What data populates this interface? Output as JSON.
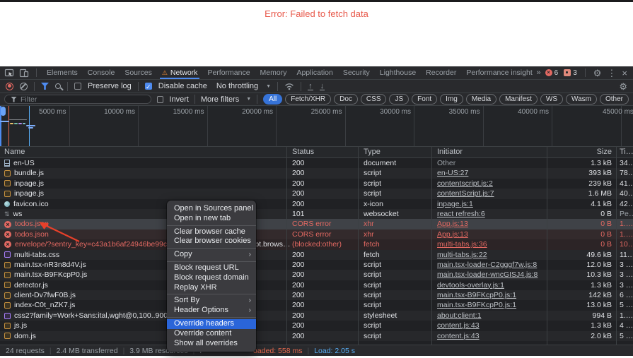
{
  "banner": {
    "text": "Error: Failed to fetch data"
  },
  "tabs": {
    "items": [
      {
        "label": "Elements"
      },
      {
        "label": "Console"
      },
      {
        "label": "Sources"
      },
      {
        "label": "Network",
        "selected": true,
        "warning": true
      },
      {
        "label": "Performance"
      },
      {
        "label": "Memory"
      },
      {
        "label": "Application"
      },
      {
        "label": "Security"
      },
      {
        "label": "Lighthouse"
      },
      {
        "label": "Recorder"
      },
      {
        "label": "Performance insights",
        "flask": true
      }
    ],
    "overflow_chevron": "»",
    "error_count": "6",
    "issue_count": "3"
  },
  "toolbar": {
    "preserve_log_label": "Preserve log",
    "disable_cache_label": "Disable cache",
    "throttling_value": "No throttling",
    "check_glyph": "✓"
  },
  "filterbar": {
    "placeholder": "Filter",
    "invert_label": "Invert",
    "more_filters_label": "More filters",
    "chips": [
      "All",
      "Fetch/XHR",
      "Doc",
      "CSS",
      "JS",
      "Font",
      "Img",
      "Media",
      "Manifest",
      "WS",
      "Wasm",
      "Other"
    ],
    "active_chip": "All"
  },
  "timeline": {
    "ticks": [
      "5000 ms",
      "10000 ms",
      "15000 ms",
      "20000 ms",
      "25000 ms",
      "30000 ms",
      "35000 ms",
      "40000 ms",
      "45000 ms"
    ],
    "tick_spacing_px": 97.5
  },
  "table": {
    "columns": {
      "name": "Name",
      "status": "Status",
      "type": "Type",
      "initiator": "Initiator",
      "size": "Size",
      "time": "Ti…"
    },
    "rows": [
      {
        "name": "en-US",
        "icon": "document-icon",
        "status": "200",
        "type": "document",
        "initiator": "Other",
        "initiator_style": "muted",
        "size": "1.3 kB",
        "time": "34…"
      },
      {
        "name": "bundle.js",
        "icon": "script-icon",
        "status": "200",
        "type": "script",
        "initiator": "en-US:27",
        "initiator_style": "link",
        "size": "393 kB",
        "time": "78…"
      },
      {
        "name": "inpage.js",
        "icon": "script-icon",
        "status": "200",
        "type": "script",
        "initiator": "contentscript.js:2",
        "initiator_style": "link",
        "size": "239 kB",
        "time": "41…"
      },
      {
        "name": "inpage.js",
        "icon": "script-icon",
        "status": "200",
        "type": "script",
        "initiator": "contentScript.js:7",
        "initiator_style": "link",
        "size": "1.6 MB",
        "time": "40…"
      },
      {
        "name": "favicon.ico",
        "icon": "image-icon",
        "status": "200",
        "type": "x-icon",
        "initiator": "inpage.js:1",
        "initiator_style": "link",
        "size": "4.1 kB",
        "time": "42…"
      },
      {
        "name": "ws",
        "icon": "websocket-icon",
        "status": "101",
        "type": "websocket",
        "initiator": "react refresh:6",
        "initiator_style": "link",
        "size": "0 B",
        "time": "Pe…",
        "time_muted": true
      },
      {
        "name": "todos.json",
        "icon": "error-icon",
        "status": "CORS error",
        "type": "xhr",
        "initiator": "App.js:13",
        "initiator_style": "link",
        "size": "0 B",
        "time": "1.…",
        "error": true,
        "selected": true
      },
      {
        "name": "todos.json",
        "icon": "error-icon",
        "status": "CORS error",
        "type": "xhr",
        "initiator": "App.js:13",
        "initiator_style": "link",
        "size": "0 B",
        "time": "1.…",
        "error": true
      },
      {
        "name": "envelope/?sentry_key=c43a1b6af24946be99c06b2dcda",
        "name_tail": "ipt.brows…",
        "icon": "error-icon",
        "status": "(blocked:other)",
        "type": "fetch",
        "initiator": "multi-tabs.js:36",
        "initiator_style": "link",
        "size": "0 B",
        "time": "10…",
        "error": true
      },
      {
        "name": "multi-tabs.css",
        "icon": "stylesheet-icon",
        "status": "200",
        "type": "fetch",
        "initiator": "multi-tabs.js:22",
        "initiator_style": "link",
        "size": "49.6 kB",
        "time": "11…"
      },
      {
        "name": "main.tsx-nR3n8d4V.js",
        "icon": "script-icon",
        "status": "200",
        "type": "script",
        "initiator": "main.tsx-loader-C2gggf7w.js:8",
        "initiator_style": "link",
        "size": "12.0 kB",
        "time": "3 …"
      },
      {
        "name": "main.tsx-B9FKcpP0.js",
        "icon": "script-icon",
        "status": "200",
        "type": "script",
        "initiator": "main.tsx-loader-wncGISJ4.js:8",
        "initiator_style": "link",
        "size": "10.3 kB",
        "time": "3 …"
      },
      {
        "name": "detector.js",
        "icon": "script-icon",
        "status": "200",
        "type": "script",
        "initiator": "devtools-overlay.js:1",
        "initiator_style": "link",
        "size": "1.3 kB",
        "time": "3 …"
      },
      {
        "name": "client-Dv7fwF0B.js",
        "icon": "script-icon",
        "status": "200",
        "type": "script",
        "initiator": "main.tsx-B9FKcpP0.js:1",
        "initiator_style": "link",
        "size": "142 kB",
        "time": "6 …"
      },
      {
        "name": "index-C0t_nZK7.js",
        "icon": "script-icon",
        "status": "200",
        "type": "script",
        "initiator": "main.tsx-B9FKcpP0.js:1",
        "initiator_style": "link",
        "size": "13.0 kB",
        "time": "5 …"
      },
      {
        "name": "css2?family=Work+Sans:ital,wght@0,100..900;1,100..900",
        "icon": "stylesheet-icon",
        "status": "200",
        "type": "stylesheet",
        "initiator": "about:client:1",
        "initiator_style": "link",
        "size": "994 B",
        "time": "1.…"
      },
      {
        "name": "js.js",
        "icon": "script-icon",
        "status": "200",
        "type": "script",
        "initiator": "content.js:43",
        "initiator_style": "link",
        "size": "1.3 kB",
        "time": "4 …"
      },
      {
        "name": "dom.js",
        "icon": "script-icon",
        "status": "200",
        "type": "script",
        "initiator": "content.js:43",
        "initiator_style": "link",
        "size": "2.0 kB",
        "time": "5 …"
      }
    ]
  },
  "context_menu": {
    "items": [
      {
        "label": "Open in Sources panel"
      },
      {
        "label": "Open in new tab"
      },
      {
        "separator": true
      },
      {
        "label": "Clear browser cache"
      },
      {
        "label": "Clear browser cookies"
      },
      {
        "separator": true
      },
      {
        "label": "Copy",
        "submenu": true
      },
      {
        "separator": true
      },
      {
        "label": "Block request URL"
      },
      {
        "label": "Block request domain"
      },
      {
        "label": "Replay XHR"
      },
      {
        "separator": true
      },
      {
        "label": "Sort By",
        "submenu": true
      },
      {
        "label": "Header Options",
        "submenu": true
      },
      {
        "separator": true
      },
      {
        "label": "Override headers",
        "highlighted": true
      },
      {
        "label": "Override content"
      },
      {
        "label": "Show all overrides"
      }
    ]
  },
  "status_bar": {
    "requests": "24 requests",
    "transferred": "2.4 MB transferred",
    "resources": "3.9 MB resources",
    "finish_partial": "F",
    "domcontentloaded_partial": "oaded: 558 ms",
    "load": "Load: 2.05 s"
  },
  "colors": {
    "banner_red": "#e8584a",
    "accent_blue": "#4e8bf0",
    "selection_blue": "#2a65d9",
    "error_red": "#e46962",
    "dcl_orange": "#e5694e",
    "load_blue": "#58aef5"
  }
}
